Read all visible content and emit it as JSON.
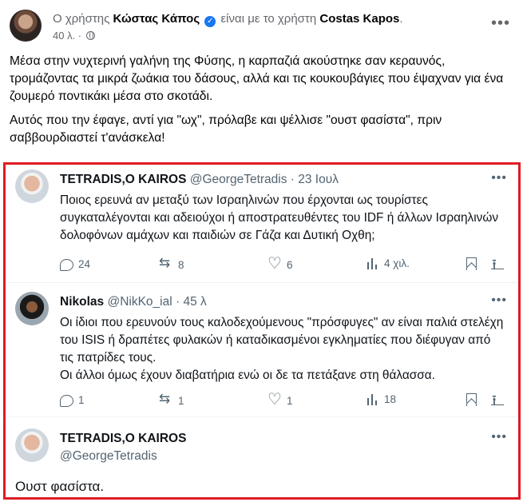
{
  "post": {
    "prefix": "Ο χρήστης",
    "author": "Κώστας Κάπος",
    "with_text": "είναι με το χρήστη",
    "tagged": "Costas Kapos",
    "time": "40 λ.",
    "paragraph1": "Μέσα στην νυχτερινή γαλήνη της Φύσης, η καρπαζιά ακούστηκε σαν κεραυνός, τρομάζοντας τα μικρά ζωάκια του δάσους, αλλά και τις κουκουβάγιες που έψαχναν για ένα ζουμερό ποντικάκι μέσα στο σκοτάδι.",
    "paragraph2": "Αυτός που την έφαγε, αντί για \"ωχ\", πρόλαβε και ψέλλισε \"ουστ φασίστα\", πριν σαββουρδιαστεί τ'ανάσκελα!"
  },
  "tweets": [
    {
      "name": "TETRADIS,O KAIROS",
      "handle": "@GeorgeTetradis",
      "meta": "· 23 Ιουλ",
      "text": "Ποιος ερευνά αν μεταξύ των Ισραηλινών που έρχονται ως τουρίστες συγκαταλέγονται και αδειούχοι ή αποστρατευθέντες του IDF ή άλλων Ισραηλινών δολοφόνων αμάχων και παιδιών σε Γάζα και Δυτική Οχθη;",
      "replies": "24",
      "retweets": "8",
      "likes": "6",
      "views": "4 χιλ."
    },
    {
      "name": "Nikolas",
      "handle": "@NikKo_ial",
      "meta": "· 45 λ",
      "text": "Οι ίδιοι που ερευνούν τους καλοδεχούμενους \"πρόσφυγες\" αν είναι παλιά στελέχη του ISIS ή δραπέτες φυλακών ή καταδικασμένοι εγκληματίες που διέφυγαν από τις πατρίδες τους.\nΟι άλλοι όμως έχουν διαβατήρια ενώ οι δε τα πετάξανε στη θάλασσα.",
      "replies": "1",
      "retweets": "1",
      "likes": "1",
      "views": "18"
    },
    {
      "name": "TETRADIS,O KAIROS",
      "handle": "@GeorgeTetradis",
      "text": "Ουστ φασίστα."
    }
  ],
  "colors": {
    "highlight_border": "#e01b24",
    "verified": "#1877f2"
  }
}
